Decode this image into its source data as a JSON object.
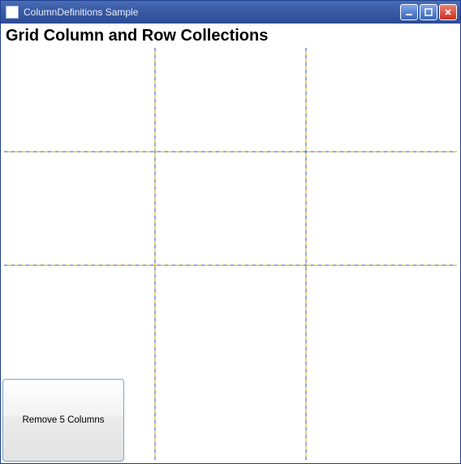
{
  "window": {
    "title": "ColumnDefinitions Sample"
  },
  "heading": "Grid Column and Row Collections",
  "grid": {
    "columns": 3,
    "rows": 3
  },
  "buttons": {
    "remove5": "Remove 5 Columns"
  },
  "colors": {
    "grid_blue": "#3050c0",
    "grid_yellow": "#d8a800",
    "titlebar_top": "#4a6db8",
    "titlebar_bottom": "#2d4c94",
    "button_border": "#7da2ce"
  }
}
